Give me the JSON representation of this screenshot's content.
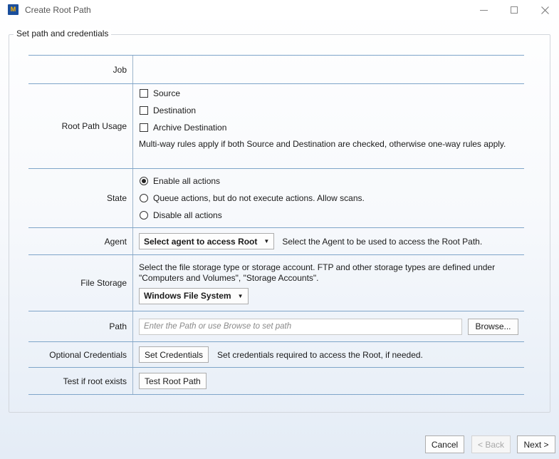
{
  "window": {
    "title": "Create Root Path",
    "icon_label": "M"
  },
  "group": {
    "legend": "Set path and credentials"
  },
  "form": {
    "job": {
      "label": "Job",
      "value": ""
    },
    "usage": {
      "label": "Root Path Usage",
      "options": [
        "Source",
        "Destination",
        "Archive Destination"
      ],
      "checked": [
        false,
        false,
        false
      ],
      "note": "Multi-way rules apply if both Source and Destination are checked, otherwise one-way rules apply."
    },
    "state": {
      "label": "State",
      "options": [
        "Enable all actions",
        "Queue actions, but do not execute actions. Allow scans.",
        "Disable all actions"
      ],
      "selected": "Enable all actions"
    },
    "agent": {
      "label": "Agent",
      "dropdown": "Select agent to access Root",
      "help": "Select the Agent to be used to access the Root Path."
    },
    "storage": {
      "label": "File Storage",
      "help": "Select the file storage type or storage account. FTP and other storage types are defined under \"Computers and Volumes\", \"Storage Accounts\".",
      "dropdown": "Windows File System"
    },
    "path": {
      "label": "Path",
      "placeholder": "Enter the Path or use Browse to set path",
      "browse": "Browse..."
    },
    "credentials": {
      "label": "Optional Credentials",
      "button": "Set Credentials",
      "help": "Set credentials required to access the Root, if needed."
    },
    "test": {
      "label": "Test if root exists",
      "button": "Test Root Path"
    }
  },
  "footer": {
    "cancel": "Cancel",
    "back": "< Back",
    "next": "Next >"
  },
  "colors": {
    "row_border": "#7fa5c9",
    "app_icon": "#1b4f9c"
  }
}
